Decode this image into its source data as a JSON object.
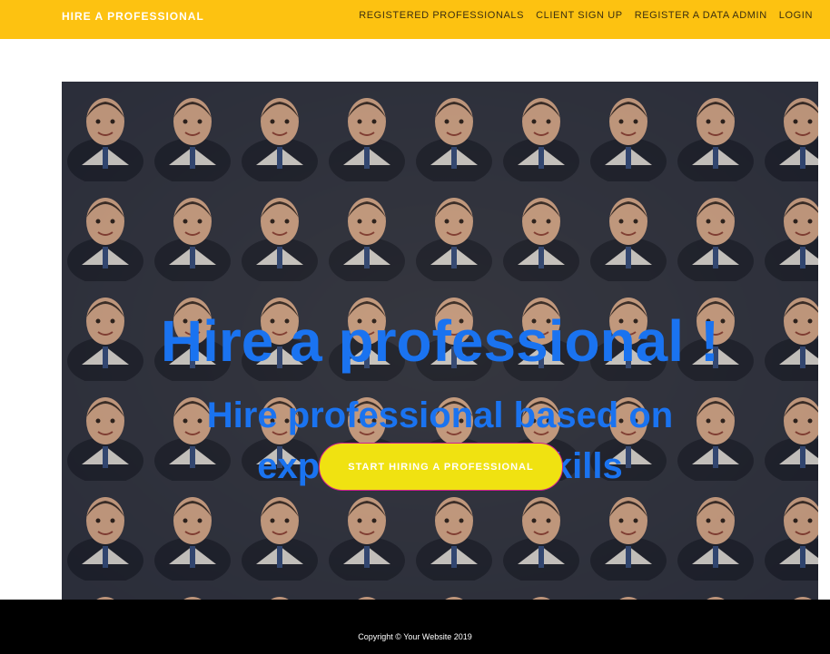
{
  "navbar": {
    "brand": "HIRE A PROFESSIONAL",
    "links": [
      "REGISTERED PROFESSIONALS",
      "CLIENT SIGN UP",
      "REGISTER A DATA ADMIN",
      "LOGIN"
    ]
  },
  "hero": {
    "title": "Hire a professional !",
    "subtitle": "Hire professional based on experience and skills",
    "cta_label": "START HIRING A PROFESSIONAL"
  },
  "footer": {
    "copyright": "Copyright © Your Website 2019"
  },
  "colors": {
    "navbar_bg": "#fdc211",
    "heading_blue": "#1a73f0",
    "cta_bg": "#f0e211",
    "cta_border": "#d0208f",
    "footer_bg": "#000000"
  },
  "icons": []
}
